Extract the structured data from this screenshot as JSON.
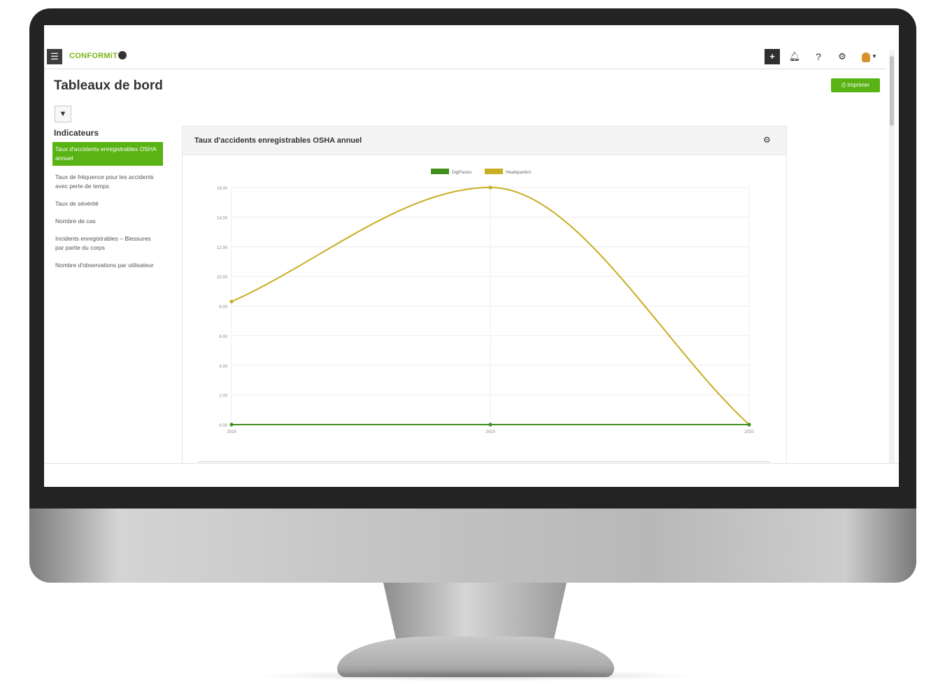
{
  "app": {
    "logo_text": "CONFORMiT",
    "page_title": "Tableaux de bord",
    "print_label": "Imprimer"
  },
  "topbar": {
    "icons": [
      "menu-icon",
      "plus-icon",
      "bell-icon",
      "help-icon",
      "gear-icon",
      "user-avatar-icon"
    ],
    "help_glyph": "?"
  },
  "filter": {
    "icon": "filter-icon"
  },
  "indicators": {
    "title": "Indicateurs",
    "items": [
      {
        "label": "Taux d'accidents enregistrables OSHA annuel",
        "active": true
      },
      {
        "label": "Taux de fréquence pour les accidents avec perte de temps",
        "active": false
      },
      {
        "label": "Taux de sévérité",
        "active": false
      },
      {
        "label": "Nombre de cas",
        "active": false
      },
      {
        "label": "Incidents enregistrables – Blessures par partie du corps",
        "active": false
      },
      {
        "label": "Nombre d'observations par utilisateur",
        "active": false
      }
    ]
  },
  "panel": {
    "title": "Taux d'accidents enregistrables OSHA annuel",
    "settings_icon": "gear-icon"
  },
  "colors": {
    "brand_green": "#5ab314",
    "series_1": "#3f8f1d",
    "series_2": "#c8ae22"
  },
  "chart_data": {
    "type": "line",
    "x": [
      "2018",
      "2019",
      "2020"
    ],
    "series": [
      {
        "name": "DigiFactus",
        "values": [
          0,
          0,
          0
        ]
      },
      {
        "name": "Headquarters",
        "values": [
          8.3,
          16.0,
          0
        ]
      }
    ],
    "yticks": [
      "0.00",
      "2.00",
      "4.00",
      "6.00",
      "8.00",
      "10.00",
      "12.00",
      "14.00",
      "16.00"
    ],
    "ylim": [
      0,
      16
    ],
    "legend_position": "top",
    "grid": true,
    "smooth": true
  }
}
